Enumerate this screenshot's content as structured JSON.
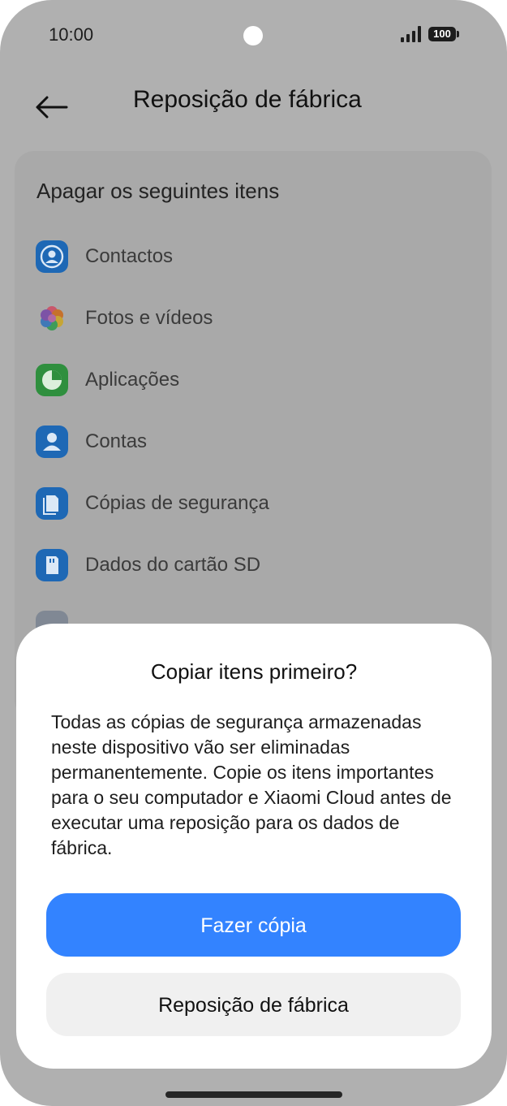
{
  "status_bar": {
    "time": "10:00",
    "battery": "100"
  },
  "header": {
    "title": "Reposição de fábrica"
  },
  "card": {
    "title": "Apagar os seguintes itens",
    "items": [
      {
        "label": "Contactos",
        "icon": "contacts-icon"
      },
      {
        "label": "Fotos e vídeos",
        "icon": "photos-icon"
      },
      {
        "label": "Aplicações",
        "icon": "apps-icon"
      },
      {
        "label": "Contas",
        "icon": "accounts-icon"
      },
      {
        "label": "Cópias de segurança",
        "icon": "backup-icon"
      },
      {
        "label": "Dados do cartão SD",
        "icon": "sd-card-icon"
      }
    ]
  },
  "dialog": {
    "title": "Copiar itens primeiro?",
    "text": "Todas as cópias de segurança armazenadas neste dispositivo vão ser eliminadas permanentemente. Copie os itens importantes para o seu computador e Xiaomi Cloud antes de executar uma reposição para os dados de fábrica.",
    "primary_label": "Fazer cópia",
    "secondary_label": "Reposição de fábrica"
  },
  "colors": {
    "accent": "#3383ff",
    "overlay": "#b0b0b0"
  }
}
